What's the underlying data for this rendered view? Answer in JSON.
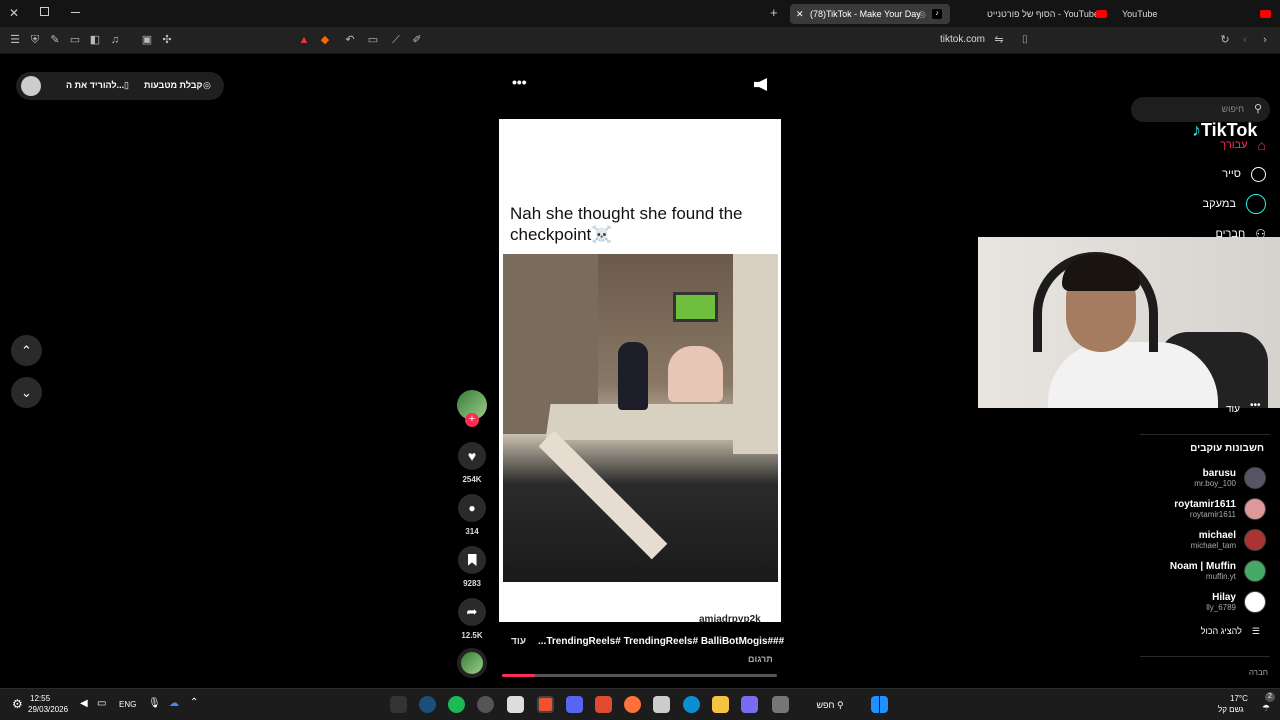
{
  "browser": {
    "tabs": [
      {
        "title": "(78)TikTok - Make Your Day",
        "active": true
      },
      {
        "title": "הסוף של פורטנייט - YouTube",
        "active": false
      },
      {
        "title": "YouTube",
        "active": false
      }
    ],
    "address": "tiktok.com",
    "new_tab": "+"
  },
  "tiktok": {
    "logo": "TikTok",
    "search_placeholder": "חיפוש",
    "nav": [
      {
        "label": "עבורך",
        "icon": "home-icon",
        "active": true
      },
      {
        "label": "סייר",
        "icon": "compass-icon",
        "active": false
      },
      {
        "label": "במעקב",
        "icon": "following-icon",
        "active": false
      },
      {
        "label": "חברים",
        "icon": "friends-icon",
        "active": false
      }
    ],
    "more_label": "עוד",
    "following_header": "חשבונות עוקבים",
    "following": [
      {
        "name": "barusu",
        "user": "mr.boy_100"
      },
      {
        "name": "roytamir1611",
        "user": "roytamir1611"
      },
      {
        "name": "michael",
        "user": "michael_tam"
      },
      {
        "name": "Noam | Muffin",
        "user": "muffin.yt"
      },
      {
        "name": "Hilay",
        "user": "lly_6789"
      }
    ],
    "show_all": "להציג הכול",
    "company": "חברה",
    "get_coins": "קבלת מטבעות",
    "download": "להוריד את ה...",
    "video": {
      "caption": "Nah she thought she found the checkpoint☠️",
      "author": "amjadrpyp2k",
      "hashtags": "...TrendingReels# TrendingReels# BalliBotMogis###",
      "more": "עוד",
      "translate": "תרגום",
      "progress": 0.12
    },
    "actions": {
      "likes": "254K",
      "comments": "314",
      "saves": "9283",
      "shares": "12.5K"
    }
  },
  "taskbar": {
    "time": "12:55",
    "date": "29/03/2026",
    "lang": "ENG",
    "search": "חפש",
    "weather_temp": "17°C",
    "weather_desc": "גשם קל",
    "notif_count": "2"
  },
  "colors": {
    "accent": "#fe2c55",
    "teal": "#25f4ee",
    "bg": "#000000"
  }
}
